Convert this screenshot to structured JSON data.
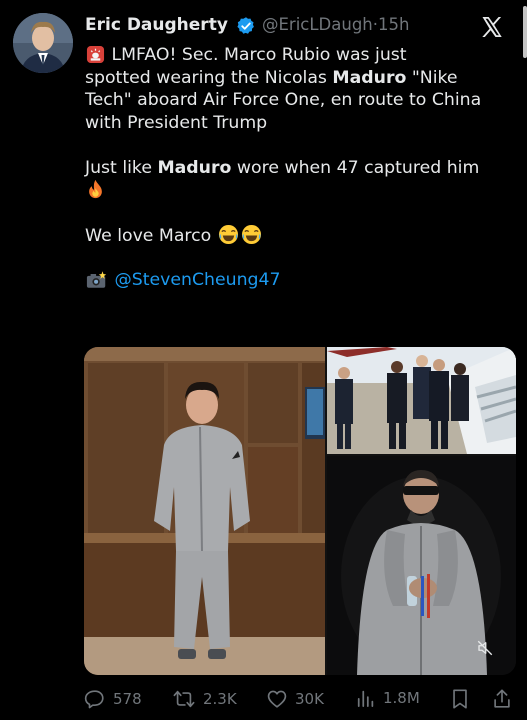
{
  "author": {
    "name": "Eric Daugherty",
    "handle": "@EricLDaugh",
    "time_sep": "·",
    "time": "15h"
  },
  "tweet": {
    "line1_text": " LMFAO! Sec. Marco Rubio was just",
    "line2_a": "spotted wearing the Nicolas ",
    "line2_bold": "Maduro",
    "line2_b": " \"Nike",
    "line3": "Tech\" aboard Air Force One, en route to China",
    "line4": "with President Trump",
    "line5_a": "Just like ",
    "line5_bold": "Maduro",
    "line5_b": " wore when 47 captured him",
    "line6_text": "We love Marco ",
    "credit_mention": "@StevenCheung47"
  },
  "actions": {
    "replies": "578",
    "reposts": "2.3K",
    "likes": "30K",
    "views": "1.8M"
  },
  "colors": {
    "background": "#000000",
    "text": "#e7e9ea",
    "muted": "#71767b",
    "link": "#1d9bf0",
    "verified": "#1d9bf0"
  },
  "icons": [
    "avatar",
    "verified-badge-icon",
    "x-logo-icon",
    "siren-emoji-icon",
    "fire-emoji-icon",
    "laughing-emoji-icon",
    "camera-flash-emoji-icon",
    "mute-icon",
    "reply-icon",
    "repost-icon",
    "like-icon",
    "views-icon",
    "bookmark-icon",
    "share-icon"
  ]
}
